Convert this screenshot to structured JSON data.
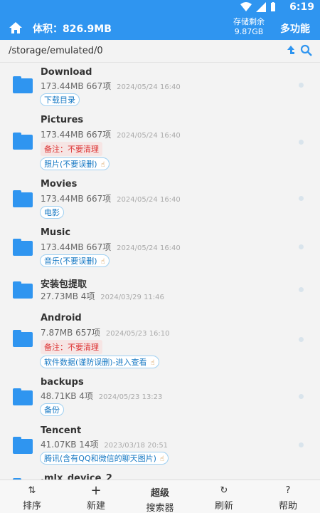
{
  "status": {
    "time": "6:19"
  },
  "appbar": {
    "volume": "体积：826.9MB",
    "storage_label": "存储剩余",
    "storage_value": "9.87GB",
    "multi_label": "多功能"
  },
  "pathbar": {
    "path": "/storage/emulated/0"
  },
  "items": [
    {
      "name": "Download",
      "size": "173.44MB",
      "count": "667项",
      "date": "2024/05/24 16:40",
      "tag": "下载目录"
    },
    {
      "name": "Pictures",
      "size": "173.44MB",
      "count": "667项",
      "date": "2024/05/24 16:40",
      "note": "备注：不要清理",
      "tag": "照片(不要误删)"
    },
    {
      "name": "Movies",
      "size": "173.44MB",
      "count": "667项",
      "date": "2024/05/24 16:40",
      "tag": "电影"
    },
    {
      "name": "Music",
      "size": "173.44MB",
      "count": "667项",
      "date": "2024/05/24 16:40",
      "tag": "音乐(不要误删)"
    },
    {
      "name": "安装包提取",
      "size": "27.73MB",
      "count": "4项",
      "date": "2024/03/29 11:46"
    },
    {
      "name": "Android",
      "size": "7.87MB",
      "count": "657项",
      "date": "2024/05/23 16:10",
      "note": "备注：不要清理",
      "tag": "软件数据(谨防误删)-进入查看"
    },
    {
      "name": "backups",
      "size": "48.71KB",
      "count": "4项",
      "date": "2024/05/23 13:23",
      "tag": "备份"
    },
    {
      "name": "Tencent",
      "size": "41.07KB",
      "count": "14项",
      "date": "2023/03/18 20:51",
      "tag": "腾讯(含有QQ和微信的聊天图片)"
    },
    {
      "name": ".mlx_device_2"
    }
  ],
  "bottom": {
    "sort": "排序",
    "new": "新建",
    "search_l1": "超级",
    "search_l2": "搜索器",
    "refresh": "刷新",
    "help": "帮助"
  },
  "colors": {
    "primary": "#2f95f0",
    "note_text": "#dd3333",
    "tag_text": "#1779c4"
  }
}
